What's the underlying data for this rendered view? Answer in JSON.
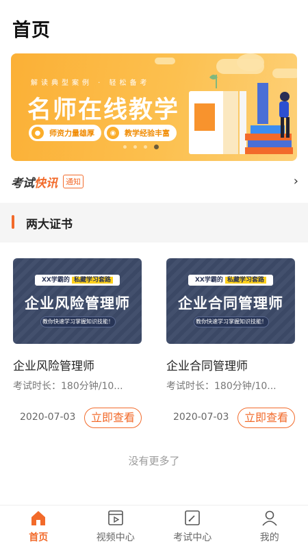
{
  "page": {
    "title": "首页"
  },
  "banner": {
    "subtitle": "解读典型案例 · 轻松备考",
    "title": "名师在线教学",
    "pills": [
      {
        "label": "师资力量雄厚",
        "icon": "teacher-icon"
      },
      {
        "label": "教学经验丰富",
        "icon": "experience-icon"
      }
    ],
    "dots_count": 4,
    "active_dot": 3,
    "colors": {
      "start": "#fbb036",
      "end": "#fdd077"
    }
  },
  "news": {
    "brand_plain": "考试",
    "brand_accent": "快讯",
    "tag": "通知",
    "arrow_icon": "chevron-right-icon"
  },
  "section": {
    "title": "两大证书"
  },
  "cards": [
    {
      "thumb_top_prefix": "XX学霸的",
      "thumb_top_highlight": "私藏学习套路",
      "thumb_main": "企业风险管理师",
      "thumb_bottom": "教你快速学习掌握知识技能！",
      "title": "企业风险管理师",
      "meta": "考试时长：180分钟/10...",
      "date": "2020-07-03",
      "button": "立即查看"
    },
    {
      "thumb_top_prefix": "XX学霸的",
      "thumb_top_highlight": "私藏学习套路",
      "thumb_main": "企业合同管理师",
      "thumb_bottom": "教你快速学习掌握知识技能！",
      "title": "企业合同管理师",
      "meta": "考试时长：180分钟/10...",
      "date": "2020-07-03",
      "button": "立即查看"
    }
  ],
  "footer_note": "没有更多了",
  "tabs": [
    {
      "label": "首页",
      "icon": "home-icon",
      "active": true
    },
    {
      "label": "视频中心",
      "icon": "video-icon",
      "active": false
    },
    {
      "label": "考试中心",
      "icon": "exam-icon",
      "active": false
    },
    {
      "label": "我的",
      "icon": "profile-icon",
      "active": false
    }
  ],
  "colors": {
    "accent": "#f26a2a",
    "card_bg": "#3d4a68",
    "highlight": "#ffd11a"
  }
}
